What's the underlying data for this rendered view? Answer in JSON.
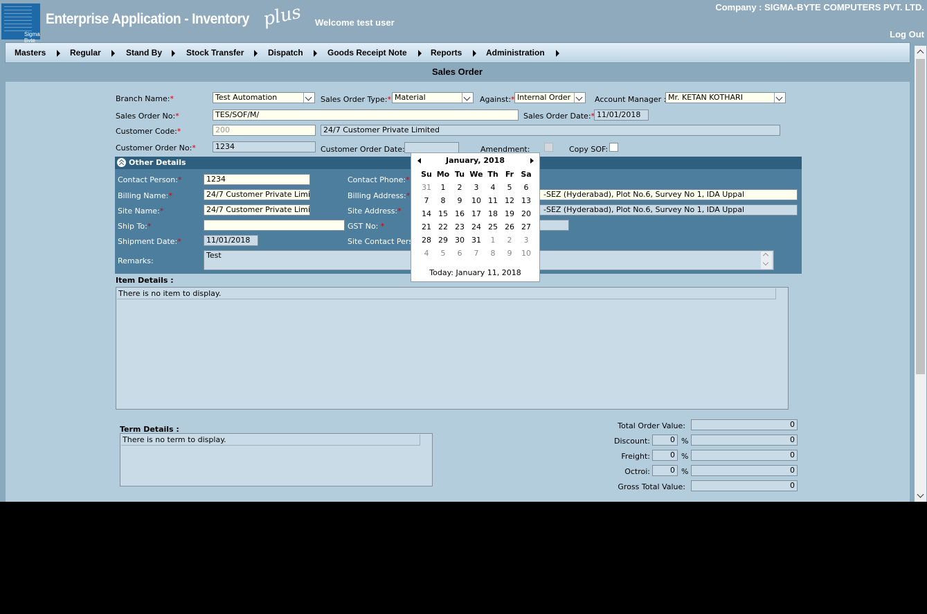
{
  "header": {
    "logo_text": "Sigma Byte",
    "app_title": "Enterprise Application - Inventory",
    "app_title_suffix": "plus",
    "welcome": "Welcome test user",
    "company": "Company : SIGMA-BYTE COMPUTERS PVT. LTD.",
    "logout": "Log Out"
  },
  "menu": [
    "Masters",
    "Regular",
    "Stand By",
    "Stock Transfer",
    "Dispatch",
    "Goods Receipt Note",
    "Reports",
    "Administration"
  ],
  "page_title": "Sales Order",
  "form": {
    "branch_label": "Branch Name:",
    "branch_value": "Test Automation",
    "so_type_label": "Sales Order Type:",
    "so_type_value": "Material",
    "against_label": "Against:",
    "against_value": "Internal Order",
    "account_manager_label": "Account Manager :",
    "account_manager_value": "Mr. KETAN KOTHARI",
    "so_no_label": "Sales Order No:",
    "so_no_value": "TES/SOF/M/",
    "so_date_label": "Sales Order Date:",
    "so_date_value": "11/01/2018",
    "customer_code_label": "Customer Code:",
    "customer_code_value": "200",
    "customer_name_value": "24/7 Customer Private Limited",
    "customer_order_no_label": "Customer Order No:",
    "customer_order_no_value": "1234",
    "customer_order_date_label": "Customer Order Date:",
    "customer_order_date_value": "",
    "amendment_label": "Amendment:",
    "copy_sof_label": "Copy SOF:",
    "required_mark": "*"
  },
  "other": {
    "title": "Other Details",
    "contact_person_label": "Contact Person:",
    "contact_person_value": "1234",
    "contact_phone_label": "Contact Phone:",
    "billing_name_label": "Billing Name:",
    "billing_name_value": "24/7 Customer Private Limited",
    "billing_address_label": "Billing Address:",
    "billing_address_value": "-SEZ (Hyderabad), Plot No.6, Survey No 1, IDA Uppal",
    "site_name_label": "Site Name:",
    "site_name_value": "24/7 Customer Private Limited",
    "site_address_label": "Site Address:",
    "site_address_value": "-SEZ (Hyderabad), Plot No.6, Survey No 1, IDA Uppal",
    "ship_to_label": "Ship To:",
    "ship_to_value": "",
    "gst_label": "GST No:",
    "shipment_date_label": "Shipment Date:",
    "shipment_date_value": "11/01/2018",
    "site_contact_label": "Site Contact Perso",
    "remarks_label": "Remarks:",
    "remarks_value": "Test"
  },
  "items": {
    "title": "Item Details :",
    "empty": "There is no item to display."
  },
  "terms": {
    "title": "Term Details :",
    "empty": "There is no term to display."
  },
  "totals": {
    "total_order_label": "Total Order Value:",
    "total_order_value": "0",
    "discount_label": "Discount:",
    "discount_pct": "0",
    "discount_value": "0",
    "freight_label": "Freight:",
    "freight_pct": "0",
    "freight_value": "0",
    "octroi_label": "Octroi:",
    "octroi_pct": "0",
    "octroi_value": "0",
    "gross_label": "Gross Total Value:",
    "gross_value": "0",
    "pct_sign": "%"
  },
  "calendar": {
    "title": "January, 2018",
    "dow": [
      "Su",
      "Mo",
      "Tu",
      "We",
      "Th",
      "Fr",
      "Sa"
    ],
    "weeks": [
      [
        "31",
        "1",
        "2",
        "3",
        "4",
        "5",
        "6"
      ],
      [
        "7",
        "8",
        "9",
        "10",
        "11",
        "12",
        "13"
      ],
      [
        "14",
        "15",
        "16",
        "17",
        "18",
        "19",
        "20"
      ],
      [
        "21",
        "22",
        "23",
        "24",
        "25",
        "26",
        "27"
      ],
      [
        "28",
        "29",
        "30",
        "31",
        "1",
        "2",
        "3"
      ],
      [
        "4",
        "5",
        "6",
        "7",
        "8",
        "9",
        "10"
      ]
    ],
    "today": "Today: January 11, 2018"
  }
}
